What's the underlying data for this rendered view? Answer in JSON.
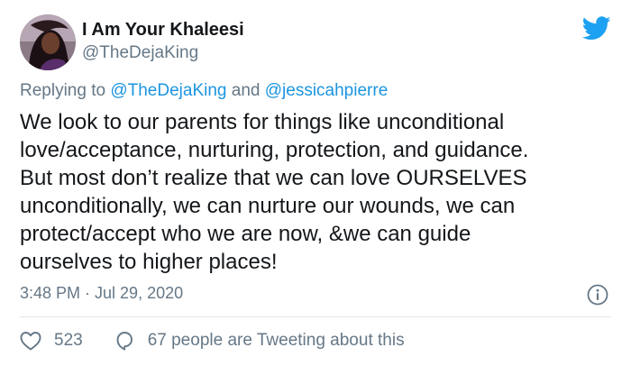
{
  "author": {
    "display_name": "I Am Your Khaleesi",
    "handle": "@TheDejaKing"
  },
  "reply_context": {
    "prefix": "Replying to",
    "mention_1": "@TheDejaKing",
    "conjunction": "and",
    "mention_2": "@jessicahpierre"
  },
  "tweet": {
    "lines": [
      "We look to our parents for things like unconditional",
      "love/acceptance, nurturing, protection, and guidance.",
      "But most don’t realize that we can love OURSELVES",
      "unconditionally, we can nurture our wounds, we can",
      "protect/accept who we are now, &we can guide",
      "ourselves to higher places!"
    ],
    "timestamp": "3:48 PM · Jul 29, 2020"
  },
  "engagement": {
    "likes": "523",
    "tweeting_about": "67 people are Tweeting about this"
  },
  "icons": {
    "brand": "twitter-bird-icon",
    "info": "info-icon",
    "like": "heart-icon",
    "reply": "speech-bubble-icon"
  },
  "colors": {
    "twitter_blue": "#1da1f2",
    "mention_blue": "#1b95e0",
    "secondary_text": "#657786",
    "primary_text": "#14171a",
    "divider": "#e1e8ed"
  }
}
